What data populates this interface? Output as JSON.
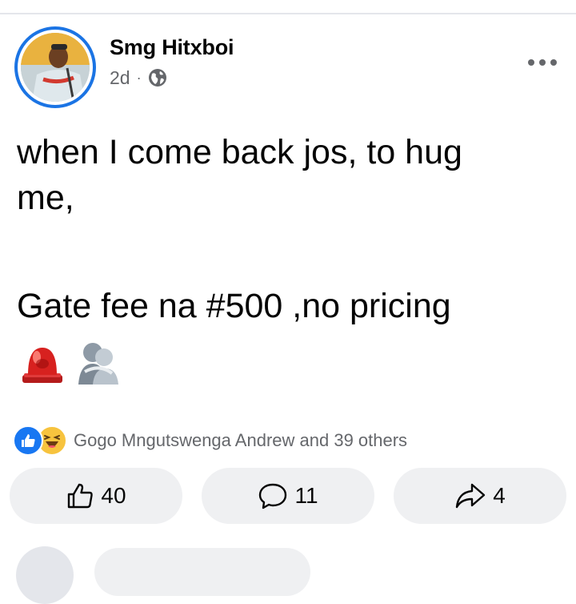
{
  "post": {
    "author": "Smg Hitxboi",
    "time": "2d",
    "separator": "·",
    "audience_icon": "globe-icon",
    "text_line1": "when I come back jos, to hug",
    "text_line2": "me,",
    "text_line3": "Gate fee na #500 ,no pricing",
    "emojis": [
      "police-light-emoji",
      "hugging-silhouette-emoji"
    ]
  },
  "reactions": {
    "icons": [
      "like",
      "haha"
    ],
    "summary": "Gogo Mngutswenga Andrew and 39 others"
  },
  "actions": {
    "like_count": "40",
    "comment_count": "11",
    "share_count": "4"
  },
  "colors": {
    "accent": "#1b74e4",
    "like_blue": "#1877f2",
    "secondary_text": "#65676b",
    "button_bg": "#eff0f2"
  }
}
